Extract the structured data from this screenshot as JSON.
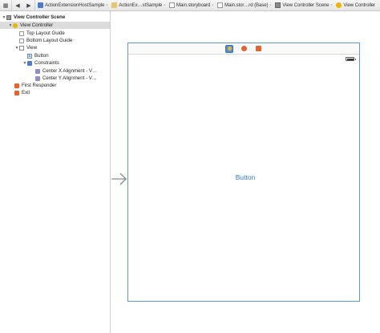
{
  "jumpbar": {
    "crumbs": [
      {
        "label": "ActionExtensionHostSample",
        "icon": "project-icon"
      },
      {
        "label": "ActionEx…stSample",
        "icon": "folder-icon"
      },
      {
        "label": "Main.storyboard",
        "icon": "storyboard-file-icon"
      },
      {
        "label": "Main.stor…rd (Base)",
        "icon": "storyboard-file-icon"
      },
      {
        "label": "View Controller Scene",
        "icon": "scene-icon"
      },
      {
        "label": "View Controller",
        "icon": "view-controller-icon"
      }
    ]
  },
  "outline": {
    "items": [
      {
        "label": "View Controller Scene",
        "level": 0,
        "icon": "scene-icon",
        "disclosure": "expanded",
        "selected": false,
        "header": true
      },
      {
        "label": "View Controller",
        "level": 1,
        "icon": "view-controller-icon",
        "disclosure": "expanded",
        "selected": true
      },
      {
        "label": "Top Layout Guide",
        "level": 2,
        "icon": "layout-guide-icon"
      },
      {
        "label": "Bottom Layout Guide",
        "level": 2,
        "icon": "layout-guide-icon"
      },
      {
        "label": "View",
        "level": 2,
        "icon": "view-icon",
        "disclosure": "expanded"
      },
      {
        "label": "Button",
        "level": 3,
        "icon": "button-icon"
      },
      {
        "label": "Constraints",
        "level": 3,
        "icon": "constraints-icon",
        "disclosure": "expanded"
      },
      {
        "label": "Center X Alignment - V…",
        "level": 4,
        "icon": "constraint-icon"
      },
      {
        "label": "Center Y Alignment - V…",
        "level": 4,
        "icon": "constraint-icon"
      },
      {
        "label": "First Responder",
        "level": 1,
        "icon": "first-responder-icon"
      },
      {
        "label": "Exit",
        "level": 1,
        "icon": "exit-icon"
      }
    ]
  },
  "canvas": {
    "button_label": "Button",
    "dock_icons": [
      "view-controller-icon",
      "first-responder-icon",
      "exit-icon"
    ]
  },
  "colors": {
    "accent": "#3478d6",
    "scene_border": "#5b9bd5",
    "selection": "#dcdcdc"
  }
}
